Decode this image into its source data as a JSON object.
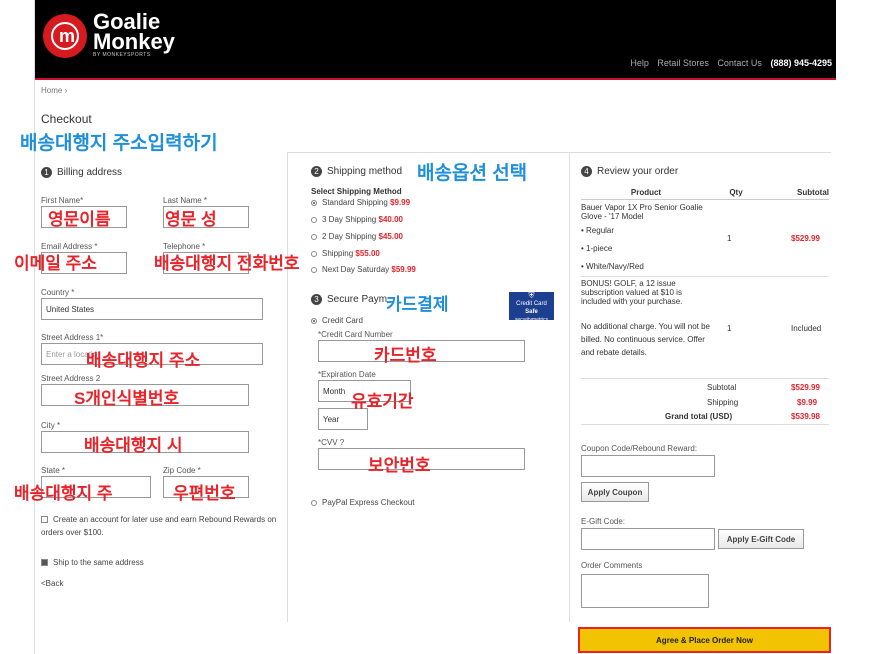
{
  "brand": {
    "line1": "Goalie",
    "line2": "Monkey",
    "sub": "BY MONKEYSPORTS",
    "mark": "m"
  },
  "topnav": {
    "help": "Help",
    "retail": "Retail Stores",
    "contact": "Contact Us",
    "phone": "(888) 945-4295"
  },
  "breadcrumb": "Home ›",
  "page_title": "Checkout",
  "billing": {
    "step": "1",
    "title": "Billing address",
    "first_name": "First Name*",
    "last_name": "Last Name *",
    "email": "Email Address *",
    "telephone": "Telephone *",
    "country_label": "Country *",
    "country_value": "United States",
    "street1_label": "Street Address 1*",
    "street1_placeholder": "Enter a locatio",
    "street2_label": "Street Address 2",
    "city_label": "City *",
    "state_label": "State *",
    "zip_label": "Zip Code *",
    "create_account": "Create an account for later use and earn Rebound Rewards on orders over $100.",
    "ship_same": "Ship to the same address",
    "back": "<Back"
  },
  "shipping": {
    "step": "2",
    "title": "Shipping method",
    "subtitle": "Select Shipping Method",
    "options": [
      {
        "label": "Standard Shipping",
        "price": "$9.99",
        "selected": true
      },
      {
        "label": "3 Day Shipping",
        "price": "$40.00",
        "selected": false
      },
      {
        "label": "2 Day Shipping",
        "price": "$45.00",
        "selected": false
      },
      {
        "label": "Shipping",
        "price": "$55.00",
        "selected": false
      },
      {
        "label": "Next Day Saturday",
        "price": "$59.99",
        "selected": false
      }
    ]
  },
  "payment": {
    "step": "3",
    "title": "Secure Paym",
    "credit_card": "Credit Card",
    "card_number_label": "*Credit Card Number",
    "expiration_label": "*Expiration Date",
    "month": "Month",
    "year": "Year",
    "cvv_label": "*CVV ?",
    "paypal": "PayPal Express Checkout",
    "badge_line1": "Credit Card",
    "badge_line2": "Safe",
    "badge_line3": "securitymetrics"
  },
  "review": {
    "step": "4",
    "title": "Review your order",
    "headers": {
      "product": "Product",
      "qty": "Qty",
      "subtotal": "Subtotal"
    },
    "item1": {
      "name": "Bauer Vapor 1X Pro Senior Goalie Glove - '17 Model",
      "opt1": "Regular",
      "opt2": "1-piece",
      "opt3": "White/Navy/Red",
      "qty": "1",
      "subtotal": "$529.99"
    },
    "item2": {
      "name": "BONUS! GOLF, a 12 issue subscription valued at $10 is included with your purchase.",
      "note": "No additional charge. You will not be billed. No continuous service. Offer and rebate details.",
      "qty": "1",
      "subtotal": "Included"
    },
    "totals": {
      "subtotal_label": "Subtotal",
      "subtotal": "$529.99",
      "shipping_label": "Shipping",
      "shipping": "$9.99",
      "grand_label": "Grand total (USD)",
      "grand": "$539.98"
    },
    "coupon_label": "Coupon Code/Rebound Reward:",
    "apply_coupon": "Apply Coupon",
    "egift_label": "E-Gift Code:",
    "apply_egift": "Apply E-Gift Code",
    "comments_label": "Order Comments",
    "place_order": "Agree & Place Order Now"
  },
  "annotations": {
    "shipping_address": "배송대행지 주소입력하기",
    "shipping_option": "배송옵션 선택",
    "first_name": "영문이름",
    "last_name": "영문 성",
    "email": "이메일 주소",
    "phone": "배송대행지 전화번호",
    "card_payment": "카드결제",
    "address": "배송대행지 주소",
    "card_number": "카드번호",
    "personal_id": "S개인식별번호",
    "expiry": "유효기간",
    "city": "배송대행지 시",
    "cvv": "보안번호",
    "state": "배송대행지 주",
    "zip": "우편번호"
  }
}
